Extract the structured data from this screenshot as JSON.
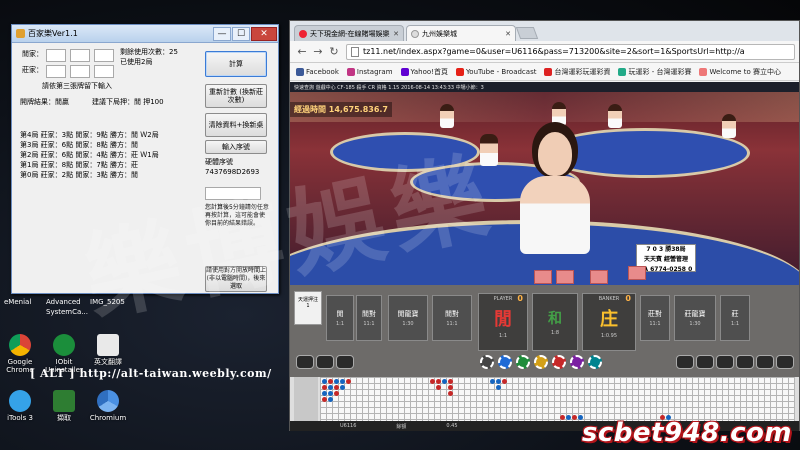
{
  "desktop": {
    "icons": [
      {
        "label": "Chrome",
        "label2": "Google"
      },
      {
        "label": "IObit",
        "label2": "Uninstaller"
      },
      {
        "label": "英文翻譯",
        "label2": ""
      },
      {
        "label": "iTools 3",
        "label2": ""
      },
      {
        "label": "擷取",
        "label2": ""
      },
      {
        "label": "Chromium",
        "label2": ""
      }
    ],
    "edge_labels": [
      "Advanced",
      "SystemCa...",
      "IMG_5205",
      "eMenial"
    ],
    "alt_url": "[ ALT ]   http://alt-taiwan.weebly.com/",
    "watermark": "樂博娛樂",
    "brand": "scbet948.com",
    "colors": {
      "brand_outline": "#b1141a"
    }
  },
  "tool_window": {
    "title": "百家樂Ver1.1",
    "controls": {
      "minimize": "—",
      "maximize": "☐",
      "close": "✕"
    },
    "banker_label": "閒家：",
    "player_label": "莊家：",
    "usage_label": "剩餘使用次數：25",
    "used_label": "已使用2局",
    "hint": "請依第三張牌留下輸入",
    "result_label": "開牌結果：閒贏",
    "next_label": "建議下局押：閒   押100",
    "log": [
      "第4局   莊家：3點   閒家：9點   勝方：閒   Ｗ2局",
      "第3局   莊家：6點   閒家：8點   勝方：閒",
      "第2局   莊家：6點   閒家：4點   勝方：莊   Ｗ1局",
      "第1局   莊家：8點   閒家：7點   勝方：莊",
      "第0局   莊家：2點   閒家：3點   勝方：閒"
    ],
    "buttons": {
      "calc": "計算",
      "reset": "重新計數 (換新莊次數)",
      "clear": "清除資料+換新桌",
      "serial": "輸入序號"
    },
    "serial_label": "硬體序號",
    "serial_value": "7437698D2693",
    "note": "您計算後5分鐘請勿任意再按計算，這可能會使你目前的結果錯誤。",
    "clock_note": "請使用對方開放時間上(非以電腦時間)，後來選取"
  },
  "browser": {
    "tabs": [
      {
        "label": "天下現金網-在線賭場娛樂",
        "active": false
      },
      {
        "label": "九州娛樂城",
        "active": true
      }
    ],
    "url": "tz11.net/index.aspx?game=0&user=U6116&pass=713200&site=2&sort=1&SportsUrl=http://a",
    "bookmarks": [
      {
        "label": "Facebook",
        "color": "#3b5998"
      },
      {
        "label": "Instagram",
        "color": "#c13584"
      },
      {
        "label": "Yahoo!首頁",
        "color": "#6001d2"
      },
      {
        "label": "YouTube - Broadcast",
        "color": "#e62117"
      },
      {
        "label": "台灣運彩玩運彩資",
        "color": "#d22"
      },
      {
        "label": "玩運彩 - 台灣運彩賽",
        "color": "#2a8"
      },
      {
        "label": "Welcome to 賽立中心",
        "color": "#e77"
      }
    ]
  },
  "game": {
    "top_info": "快速查詢    遊戲中心    CF-185  殺手  CR  資格  1.15  2016-08-14  13:43:33  中場小節：3",
    "banner": "經過時間  14,675.836.7",
    "road_card": {
      "line1": "7 0 3 勝38局",
      "line2": "天天賓 經營管理",
      "line3": "TA 6774-0258 0"
    },
    "side_label": "天運押注\n1",
    "bets": [
      {
        "label": "閒",
        "sub": "1:1"
      },
      {
        "label": "閒對",
        "sub": "11:1"
      },
      {
        "label": "閒龍寶",
        "sub": "1:30"
      },
      {
        "label": "閒對",
        "sub": "11:1"
      },
      {
        "label": "莊對",
        "sub": "11:1"
      },
      {
        "label": "莊龍寶",
        "sub": "1:30"
      },
      {
        "label": "莊",
        "sub": "1:1"
      }
    ],
    "player_box": {
      "hdr": "PLAYER",
      "glyph": "閒",
      "score": "0",
      "sub": "1:1"
    },
    "tie_box": {
      "hdr": "",
      "glyph": "和",
      "score": "",
      "sub": "1:8"
    },
    "banker_box": {
      "hdr": "BANKER",
      "glyph": "庄",
      "score": "0",
      "sub": "1:0.95"
    },
    "colors": {
      "player": "#e53935",
      "tie": "#43a047",
      "banker": "#fbc02d"
    },
    "footer": [
      "U6116",
      "餘額",
      "0.45"
    ]
  }
}
